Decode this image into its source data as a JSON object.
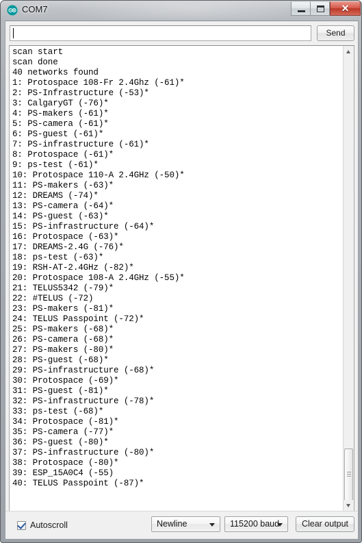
{
  "window": {
    "title": "COM7",
    "app_icon": "arduino-infinity-icon",
    "controls": {
      "minimize": "minimize-icon",
      "maximize": "maximize-icon",
      "close": "close-icon",
      "close_glyph": "✕"
    }
  },
  "send_row": {
    "input_value": "",
    "input_placeholder": "",
    "send_label": "Send"
  },
  "console": {
    "lines": [
      "scan start",
      "scan done",
      "40 networks found",
      "1: Protospace 108-Fr 2.4Ghz (-61)*",
      "2: PS-Infrastructure (-53)*",
      "3: CalgaryGT (-76)*",
      "4: PS-makers (-61)*",
      "5: PS-camera (-61)*",
      "6: PS-guest (-61)*",
      "7: PS-infrastructure (-61)*",
      "8: Protospace (-61)*",
      "9: ps-test (-61)*",
      "10: Protospace 110-A 2.4GHz (-50)*",
      "11: PS-makers (-63)*",
      "12: DREAMS (-74)*",
      "13: PS-camera (-64)*",
      "14: PS-guest (-63)*",
      "15: PS-infrastructure (-64)*",
      "16: Protospace (-63)*",
      "17: DREAMS-2.4G (-76)*",
      "18: ps-test (-63)*",
      "19: RSH-AT-2.4GHz (-82)*",
      "20: Protospace 108-A 2.4GHz (-55)*",
      "21: TELUS5342 (-79)*",
      "22: #TELUS (-72)",
      "23: PS-makers (-81)*",
      "24: TELUS Passpoint (-72)*",
      "25: PS-makers (-68)*",
      "26: PS-camera (-68)*",
      "27: PS-makers (-80)*",
      "28: PS-guest (-68)*",
      "29: PS-infrastructure (-68)*",
      "30: Protospace (-69)*",
      "31: PS-guest (-81)*",
      "32: PS-infrastructure (-78)*",
      "33: ps-test (-68)*",
      "34: Protospace (-81)*",
      "35: PS-camera (-77)*",
      "36: PS-guest (-80)*",
      "37: PS-infrastructure (-80)*",
      "38: Protospace (-80)*",
      "39: ESP_15A0C4 (-55)",
      "40: TELUS Passpoint (-87)*"
    ],
    "networks": [
      {
        "index": 1,
        "ssid": "Protospace 108-Fr 2.4Ghz",
        "rssi": -61,
        "encrypted": true
      },
      {
        "index": 2,
        "ssid": "PS-Infrastructure",
        "rssi": -53,
        "encrypted": true
      },
      {
        "index": 3,
        "ssid": "CalgaryGT",
        "rssi": -76,
        "encrypted": true
      },
      {
        "index": 4,
        "ssid": "PS-makers",
        "rssi": -61,
        "encrypted": true
      },
      {
        "index": 5,
        "ssid": "PS-camera",
        "rssi": -61,
        "encrypted": true
      },
      {
        "index": 6,
        "ssid": "PS-guest",
        "rssi": -61,
        "encrypted": true
      },
      {
        "index": 7,
        "ssid": "PS-infrastructure",
        "rssi": -61,
        "encrypted": true
      },
      {
        "index": 8,
        "ssid": "Protospace",
        "rssi": -61,
        "encrypted": true
      },
      {
        "index": 9,
        "ssid": "ps-test",
        "rssi": -61,
        "encrypted": true
      },
      {
        "index": 10,
        "ssid": "Protospace 110-A 2.4GHz",
        "rssi": -50,
        "encrypted": true
      },
      {
        "index": 11,
        "ssid": "PS-makers",
        "rssi": -63,
        "encrypted": true
      },
      {
        "index": 12,
        "ssid": "DREAMS",
        "rssi": -74,
        "encrypted": true
      },
      {
        "index": 13,
        "ssid": "PS-camera",
        "rssi": -64,
        "encrypted": true
      },
      {
        "index": 14,
        "ssid": "PS-guest",
        "rssi": -63,
        "encrypted": true
      },
      {
        "index": 15,
        "ssid": "PS-infrastructure",
        "rssi": -64,
        "encrypted": true
      },
      {
        "index": 16,
        "ssid": "Protospace",
        "rssi": -63,
        "encrypted": true
      },
      {
        "index": 17,
        "ssid": "DREAMS-2.4G",
        "rssi": -76,
        "encrypted": true
      },
      {
        "index": 18,
        "ssid": "ps-test",
        "rssi": -63,
        "encrypted": true
      },
      {
        "index": 19,
        "ssid": "RSH-AT-2.4GHz",
        "rssi": -82,
        "encrypted": true
      },
      {
        "index": 20,
        "ssid": "Protospace 108-A 2.4GHz",
        "rssi": -55,
        "encrypted": true
      },
      {
        "index": 21,
        "ssid": "TELUS5342",
        "rssi": -79,
        "encrypted": true
      },
      {
        "index": 22,
        "ssid": "#TELUS",
        "rssi": -72,
        "encrypted": false
      },
      {
        "index": 23,
        "ssid": "PS-makers",
        "rssi": -81,
        "encrypted": true
      },
      {
        "index": 24,
        "ssid": "TELUS Passpoint",
        "rssi": -72,
        "encrypted": true
      },
      {
        "index": 25,
        "ssid": "PS-makers",
        "rssi": -68,
        "encrypted": true
      },
      {
        "index": 26,
        "ssid": "PS-camera",
        "rssi": -68,
        "encrypted": true
      },
      {
        "index": 27,
        "ssid": "PS-makers",
        "rssi": -80,
        "encrypted": true
      },
      {
        "index": 28,
        "ssid": "PS-guest",
        "rssi": -68,
        "encrypted": true
      },
      {
        "index": 29,
        "ssid": "PS-infrastructure",
        "rssi": -68,
        "encrypted": true
      },
      {
        "index": 30,
        "ssid": "Protospace",
        "rssi": -69,
        "encrypted": true
      },
      {
        "index": 31,
        "ssid": "PS-guest",
        "rssi": -81,
        "encrypted": true
      },
      {
        "index": 32,
        "ssid": "PS-infrastructure",
        "rssi": -78,
        "encrypted": true
      },
      {
        "index": 33,
        "ssid": "ps-test",
        "rssi": -68,
        "encrypted": true
      },
      {
        "index": 34,
        "ssid": "Protospace",
        "rssi": -81,
        "encrypted": true
      },
      {
        "index": 35,
        "ssid": "PS-camera",
        "rssi": -77,
        "encrypted": true
      },
      {
        "index": 36,
        "ssid": "PS-guest",
        "rssi": -80,
        "encrypted": true
      },
      {
        "index": 37,
        "ssid": "PS-infrastructure",
        "rssi": -80,
        "encrypted": true
      },
      {
        "index": 38,
        "ssid": "Protospace",
        "rssi": -80,
        "encrypted": true
      },
      {
        "index": 39,
        "ssid": "ESP_15A0C4",
        "rssi": -55,
        "encrypted": false
      },
      {
        "index": 40,
        "ssid": "TELUS Passpoint",
        "rssi": -87,
        "encrypted": true
      }
    ]
  },
  "scrollbar": {
    "up_icon": "scroll-up-arrow-icon",
    "down_icon": "scroll-down-arrow-icon"
  },
  "bottom_bar": {
    "autoscroll_label": "Autoscroll",
    "autoscroll_checked": true,
    "line_ending": "Newline",
    "baud_rate": "115200 baud",
    "clear_label": "Clear output"
  },
  "colors": {
    "accent": "#00979c",
    "close_button": "#bb3727",
    "console_bg": "#ffffff",
    "console_text": "#000000",
    "chrome": "#f0f0f0"
  }
}
